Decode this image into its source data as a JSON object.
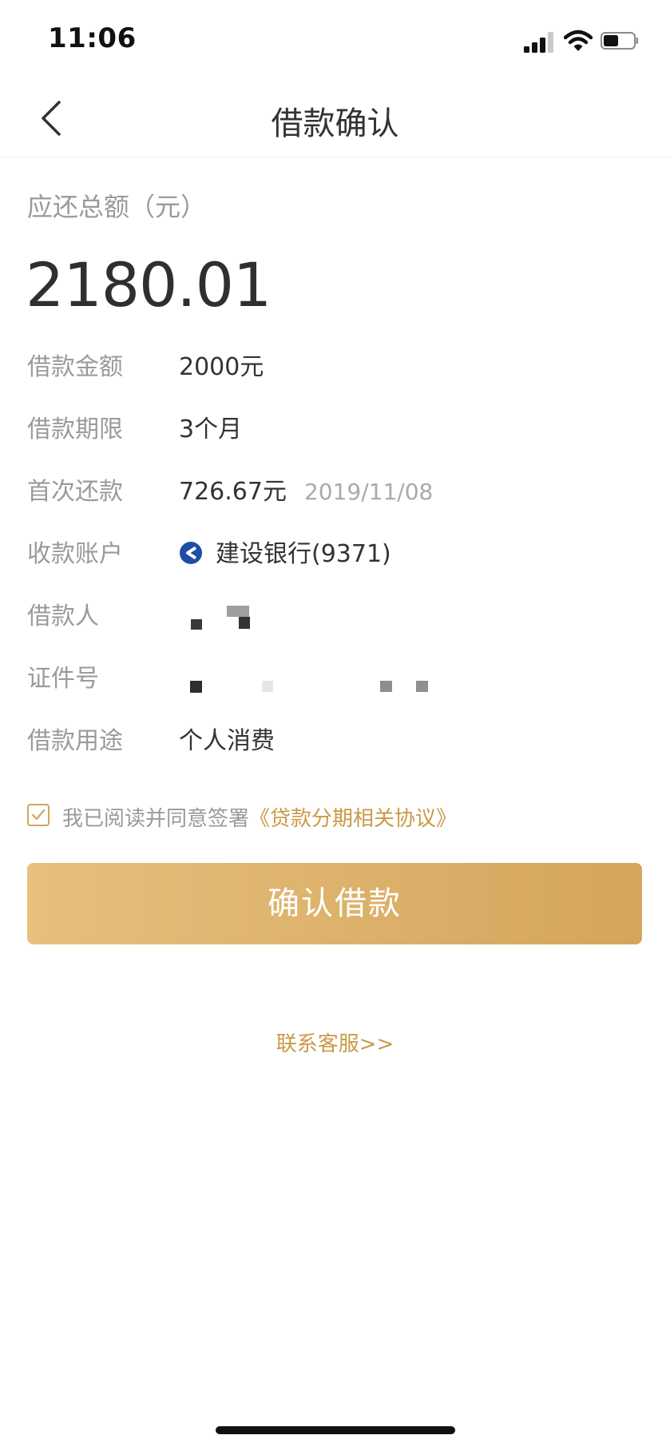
{
  "status_bar": {
    "time": "11:06",
    "icons": [
      "cellular-signal-icon",
      "wifi-icon",
      "battery-icon"
    ],
    "battery_level": 0.5
  },
  "nav": {
    "title": "借款确认",
    "back_icon": "chevron-left-icon"
  },
  "summary": {
    "total_label": "应还总额（元）",
    "total_amount": "2180.01"
  },
  "details": {
    "loan_amount": {
      "label": "借款金额",
      "value": "2000元"
    },
    "loan_term": {
      "label": "借款期限",
      "value": "3个月"
    },
    "first_payment": {
      "label": "首次还款",
      "value": "726.67元",
      "date": "2019/11/08"
    },
    "account": {
      "label": "收款账户",
      "value": "建设银行(9371)",
      "icon": "bank-logo-icon"
    },
    "borrower": {
      "label": "借款人"
    },
    "id_number": {
      "label": "证件号"
    },
    "purpose": {
      "label": "借款用途",
      "value": "个人消费"
    }
  },
  "agreement": {
    "checked": true,
    "text": "我已阅读并同意签署",
    "link": "《贷款分期相关协议》"
  },
  "actions": {
    "confirm": "确认借款",
    "contact": "联系客服>>"
  },
  "colors": {
    "accent": "#c99a48",
    "button_start": "#e6c07c",
    "button_end": "#d4a55c",
    "label": "#9a9a9a",
    "text": "#333333"
  }
}
